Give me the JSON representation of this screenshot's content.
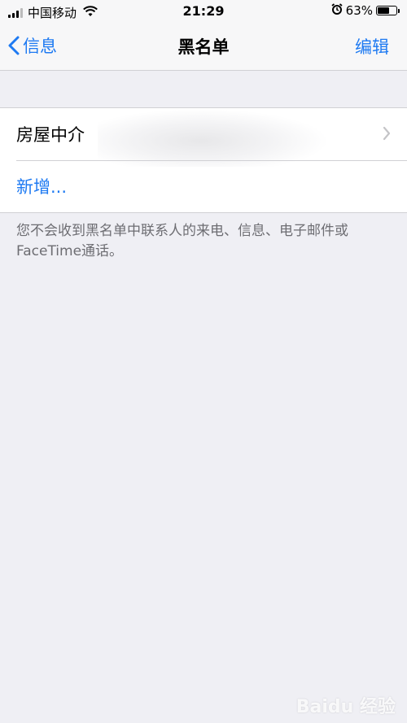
{
  "status_bar": {
    "carrier": "中国移动",
    "time": "21:29",
    "battery_percent": "63%",
    "battery_level": 0.63,
    "icons": [
      "signal-icon",
      "wifi-icon",
      "alarm-icon",
      "battery-icon"
    ]
  },
  "nav": {
    "back_label": "信息",
    "title": "黑名单",
    "edit_label": "编辑"
  },
  "list": {
    "contact_name": "房屋中介",
    "add_label": "新增..."
  },
  "footer_note": "您不会收到黑名单中联系人的来电、信息、电子邮件或FaceTime通话。",
  "watermark": "Baidu 经验",
  "colors": {
    "accent": "#1e7af2",
    "background": "#efeff4",
    "secondary_text": "#6d6d72"
  }
}
